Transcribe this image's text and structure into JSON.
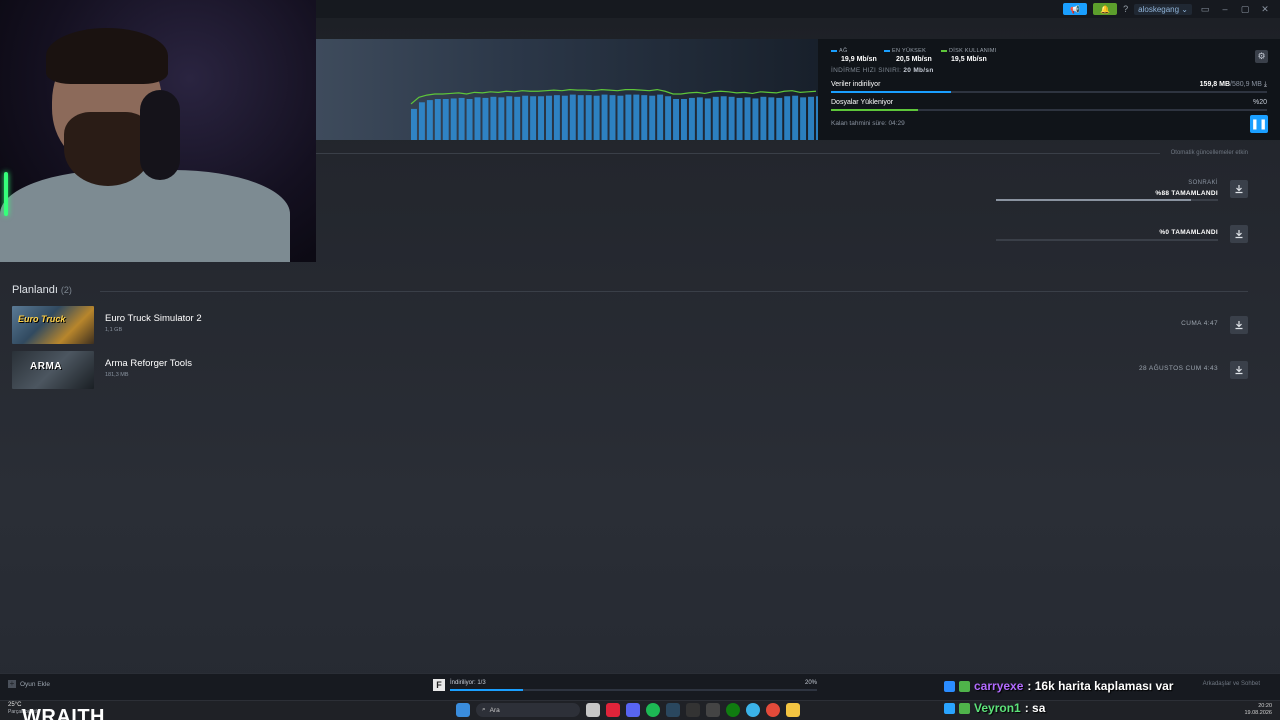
{
  "titlebar": {
    "username": "aloskegang ⌄",
    "help": "?"
  },
  "stats": {
    "network": {
      "label": "AĞ",
      "value": "19,9 Mb/sn",
      "color": "#1a9fff"
    },
    "peak": {
      "label": "EN YÜKSEK",
      "value": "20,5 Mb/sn",
      "color": "#1a9fff"
    },
    "disk": {
      "label": "DİSK KULLANIMI",
      "value": "19,5 Mb/sn",
      "color": "#5ec63a"
    },
    "limit_label": "İNDİRME HIZI SINIRI:",
    "limit_value": "20 Mb/sn"
  },
  "download": {
    "data_label": "Veriler indiriliyor",
    "data_done": "159,8 MB",
    "data_total": "/580,9 MB",
    "data_fraction": 0.275,
    "files_label": "Dosyalar Yükleniyor",
    "files_pct": "%20",
    "files_fraction": 0.2,
    "eta": "Kalan tahmini süre: 04:29"
  },
  "auto_updates_note": "Otomatik güncellemeler etkin",
  "queue": [
    {
      "sub": "SONRAKİ",
      "main": "%88 TAMAMLANDI",
      "fraction": 0.88
    },
    {
      "sub": "",
      "main": "%0 TAMAMLANDI",
      "fraction": 0.0
    }
  ],
  "scheduled": {
    "title": "Planlandı",
    "count": "(2)",
    "items": [
      {
        "name": "Euro Truck Simulator 2",
        "size": "1,1 GB",
        "when": "CUMA 4:47",
        "logo": "Euro Truck"
      },
      {
        "name": "Arma Reforger Tools",
        "size": "181,3 MB",
        "when": "28 AĞUSTOS CUM 4:43",
        "logo": "ARMA"
      }
    ]
  },
  "bottombar": {
    "add_game": "Oyun Ekle",
    "downloading": "İndiriliyor: 1/3",
    "downloading_pct": "20%",
    "downloading_fraction": 0.2,
    "friends_chat": "Arkadaşlar ve Sohbet"
  },
  "chat": [
    {
      "user": "carryexe",
      "message": ": 16k harita kaplaması var"
    },
    {
      "user": "Veyron1",
      "message": ": sa"
    }
  ],
  "taskbar": {
    "temperature": "25°C",
    "weather_desc": "Parçalı bulutlu",
    "search_placeholder": "Ara",
    "stream_overlay_text": "WRAITH",
    "time": "20:20",
    "date": "19.08.2026"
  },
  "graph_series": [
    0.62,
    0.74,
    0.78,
    0.8,
    0.8,
    0.81,
    0.82,
    0.8,
    0.83,
    0.82,
    0.84,
    0.83,
    0.85,
    0.84,
    0.86,
    0.85,
    0.85,
    0.86,
    0.87,
    0.86,
    0.88,
    0.87,
    0.87,
    0.86,
    0.88,
    0.87,
    0.86,
    0.88,
    0.88,
    0.87,
    0.86,
    0.88,
    0.85,
    0.8,
    0.8,
    0.82,
    0.83,
    0.81,
    0.84,
    0.85,
    0.84,
    0.82,
    0.83,
    0.81,
    0.84,
    0.83,
    0.82,
    0.85,
    0.86,
    0.83,
    0.84,
    0.85
  ]
}
